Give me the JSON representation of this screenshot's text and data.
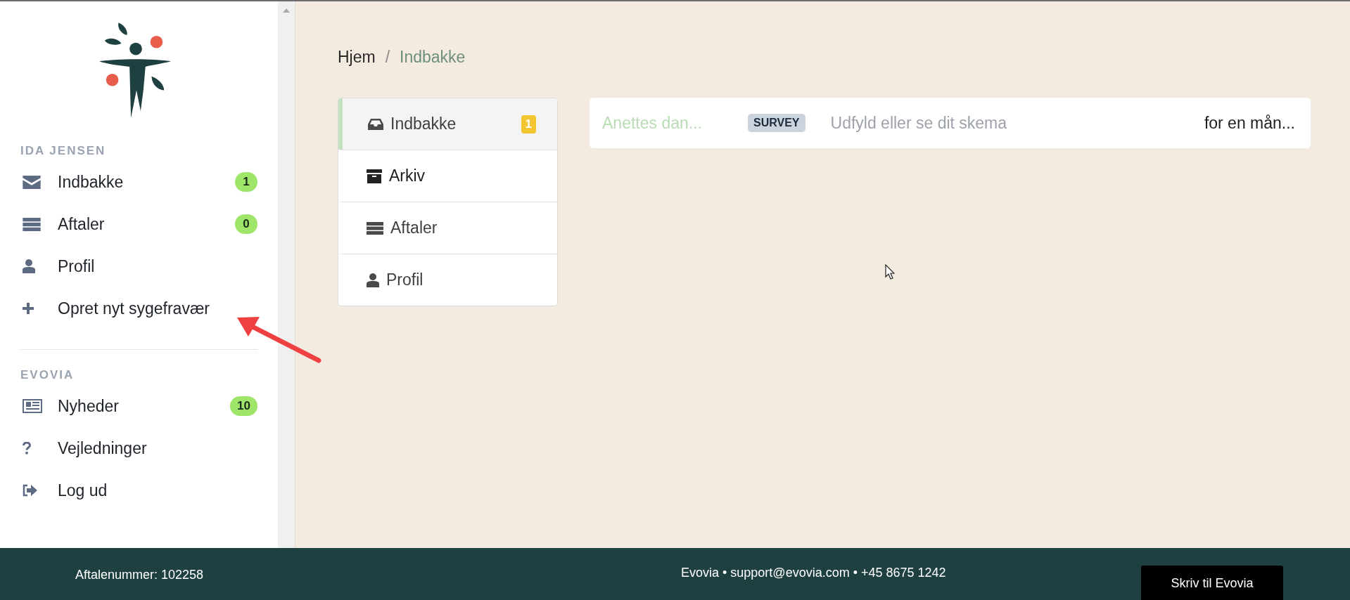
{
  "sidebar": {
    "sections": [
      {
        "title": "IDA JENSEN",
        "items": [
          {
            "kind": "envelope",
            "label": "Indbakke",
            "badge": "1"
          },
          {
            "kind": "list",
            "label": "Aftaler",
            "badge": "0"
          },
          {
            "kind": "user",
            "label": "Profil"
          },
          {
            "kind": "plus",
            "label": "Opret nyt sygefravær"
          }
        ]
      },
      {
        "title": "EVOVIA",
        "items": [
          {
            "kind": "newspaper",
            "label": "Nyheder",
            "badge": "10"
          },
          {
            "kind": "question",
            "label": "Vejledninger"
          },
          {
            "kind": "logout",
            "label": "Log ud"
          }
        ]
      }
    ]
  },
  "breadcrumb": [
    {
      "label": "Hjem",
      "current": false
    },
    {
      "label": "Indbakke",
      "current": true
    }
  ],
  "breadcrumb_separator": "/",
  "tabs": [
    {
      "kind": "inbox",
      "label": "Indbakke",
      "badge": "1",
      "selected": true
    },
    {
      "kind": "archive",
      "label": "Arkiv",
      "selected": false
    },
    {
      "kind": "list",
      "label": "Aftaler",
      "selected": false
    },
    {
      "kind": "user",
      "label": "Profil",
      "selected": false
    }
  ],
  "messages": [
    {
      "sender": "Anettes dan...",
      "tag": "SURVEY",
      "subject": "Udfyld eller se dit skema",
      "time": "for en mån..."
    }
  ],
  "footer": {
    "agreement": "Aftalenummer: 102258",
    "contact": "Evovia • support@evovia.com • +45 8675 1242",
    "button": "Skriv til Evovia"
  }
}
